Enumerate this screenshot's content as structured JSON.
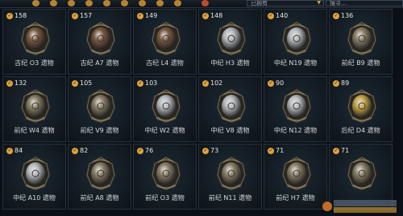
{
  "toolbar": {
    "dropdown_value": "已拥有",
    "search_placeholder": "搜寻..."
  },
  "relics": [
    {
      "count": "158",
      "name": "古纪 O3 遗物",
      "era": "古纪"
    },
    {
      "count": "157",
      "name": "古纪 A7 遗物",
      "era": "古纪"
    },
    {
      "count": "149",
      "name": "古纪 L4 遗物",
      "era": "古纪"
    },
    {
      "count": "148",
      "name": "中纪 H3 遗物",
      "era": "中纪"
    },
    {
      "count": "140",
      "name": "中纪 N19 遗物",
      "era": "中纪"
    },
    {
      "count": "136",
      "name": "前纪 B9 遗物",
      "era": "前纪"
    },
    {
      "count": "132",
      "name": "前纪 W4 遗物",
      "era": "前纪"
    },
    {
      "count": "105",
      "name": "前纪 V9 遗物",
      "era": "前纪"
    },
    {
      "count": "103",
      "name": "中纪 W2 遗物",
      "era": "中纪"
    },
    {
      "count": "102",
      "name": "中纪 V8 遗物",
      "era": "中纪"
    },
    {
      "count": "90",
      "name": "中纪 N12 遗物",
      "era": "中纪"
    },
    {
      "count": "89",
      "name": "后纪 D4 遗物",
      "era": "后纪"
    },
    {
      "count": "84",
      "name": "中纪 A10 遗物",
      "era": "中纪"
    },
    {
      "count": "82",
      "name": "前纪 A8 遗物",
      "era": "前纪"
    },
    {
      "count": "76",
      "name": "前纪 O3 遗物",
      "era": "前纪"
    },
    {
      "count": "73",
      "name": "前纪 N11 遗物",
      "era": "前纪"
    },
    {
      "count": "71",
      "name": "前纪 H7 遗物",
      "era": "前纪"
    },
    {
      "count": "71",
      "name": "",
      "era": "前纪"
    }
  ],
  "colors": {
    "古纪": "#7a5a42",
    "前纪": "#8a8068",
    "中纪": "#b8bcc0",
    "后纪": "#c9a84a",
    "accent": "#e0a23a"
  },
  "icons": {
    "owned": "check-circle-icon",
    "toolbar": [
      "filter-icon",
      "filter-icon",
      "filter-icon",
      "filter-icon",
      "filter-icon",
      "filter-icon",
      "filter-icon",
      "filter-icon",
      "filter-icon",
      "filter-icon"
    ]
  }
}
